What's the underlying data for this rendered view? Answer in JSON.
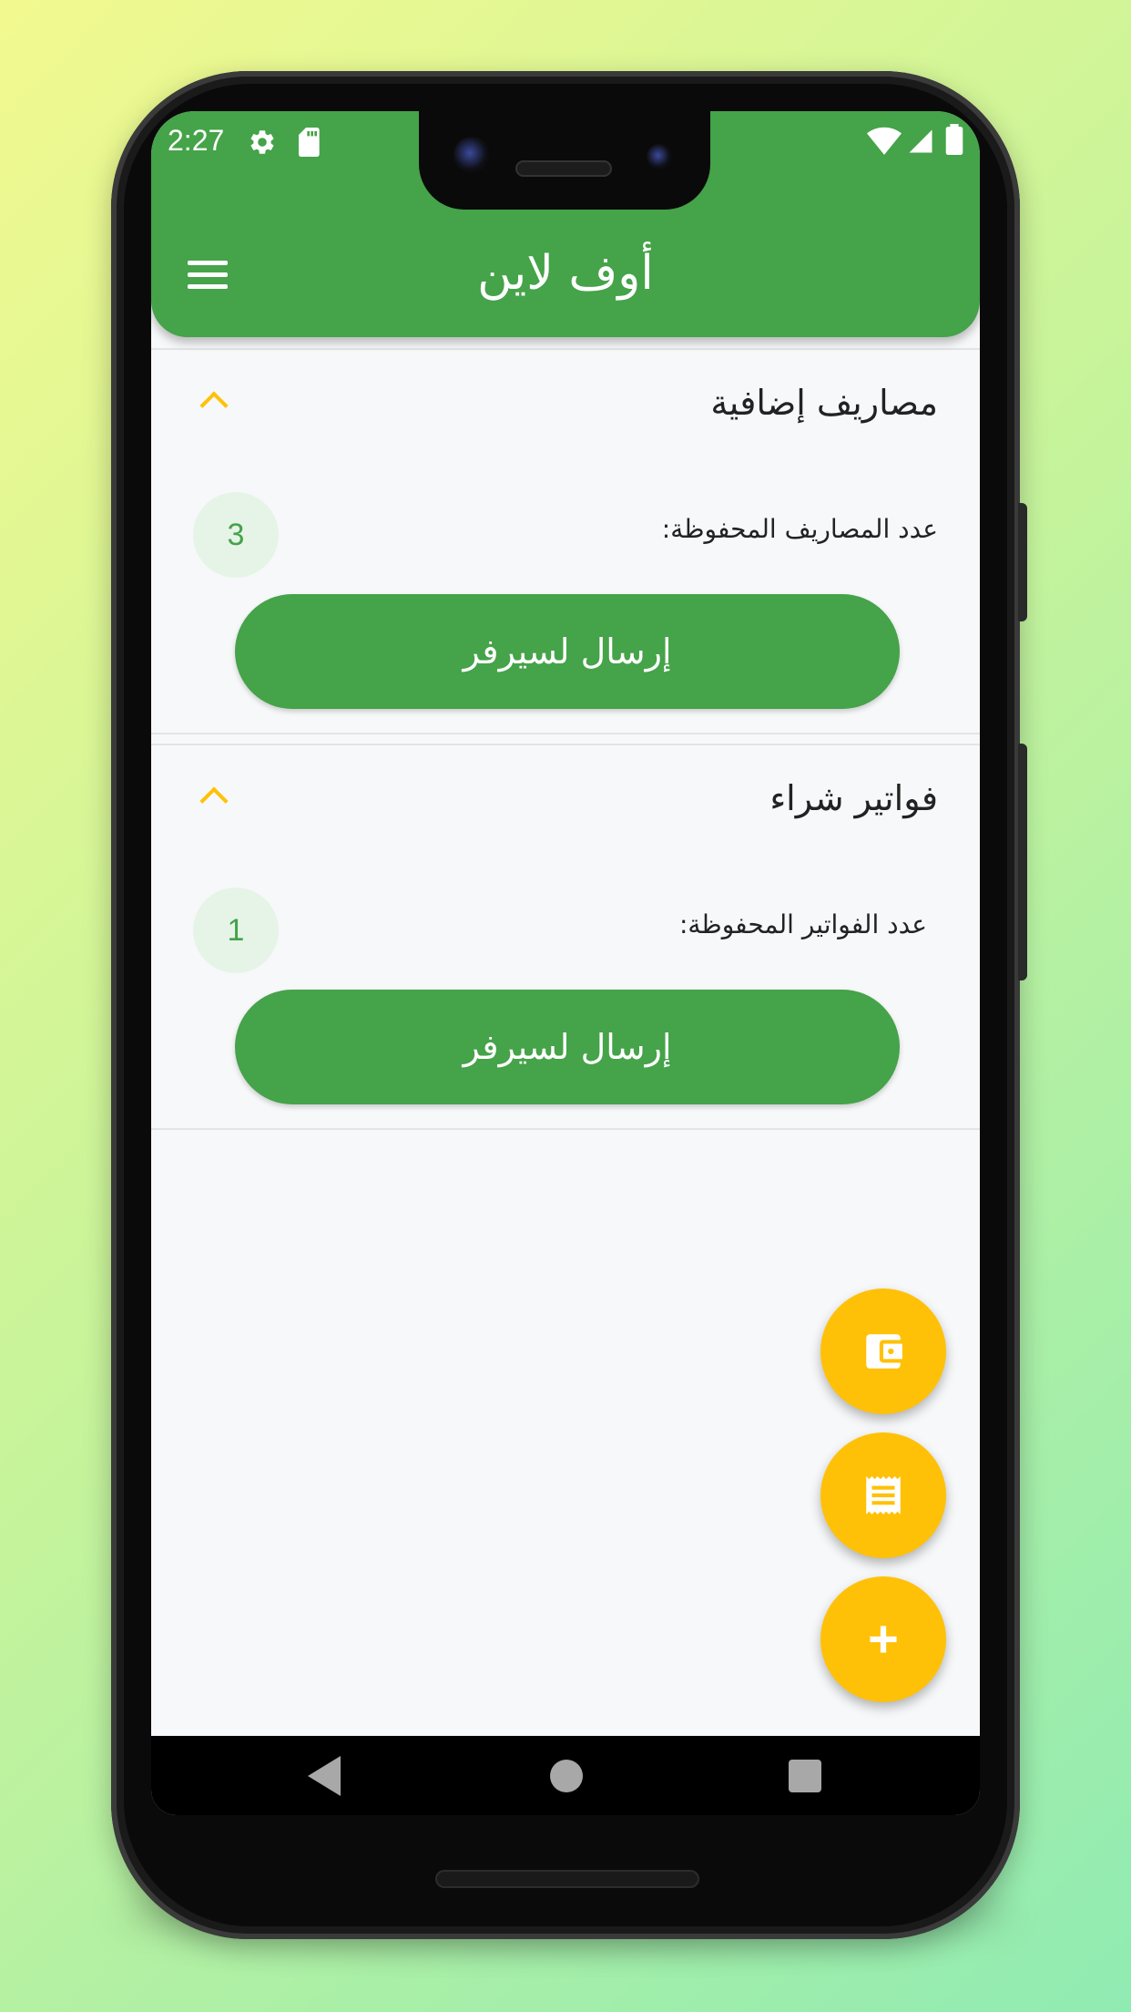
{
  "status_bar": {
    "time": "2:27",
    "icons": [
      "gear-icon",
      "sd-card-icon",
      "wifi-icon",
      "signal-icon",
      "battery-icon"
    ]
  },
  "app_bar": {
    "title": "أوف لاين",
    "menu_icon": "hamburger-menu-icon",
    "color": "#45a349"
  },
  "sections": [
    {
      "title": "مصاريف إضافية",
      "count_label": "عدد المصاريف المحفوظة:",
      "count": "3",
      "button_label": "إرسال لسيرفر",
      "expanded": true
    },
    {
      "title": "فواتير شراء",
      "count_label": "عدد الفواتير المحفوظة:",
      "count": "1",
      "button_label": "إرسال لسيرفر",
      "expanded": true
    }
  ],
  "fabs": [
    {
      "icon": "wallet-icon",
      "color": "#ffc107"
    },
    {
      "icon": "receipt-icon",
      "color": "#ffc107"
    },
    {
      "icon": "plus-icon",
      "color": "#ffc107"
    }
  ],
  "nav_bar": {
    "buttons": [
      "back-icon",
      "home-icon",
      "recents-icon"
    ]
  }
}
